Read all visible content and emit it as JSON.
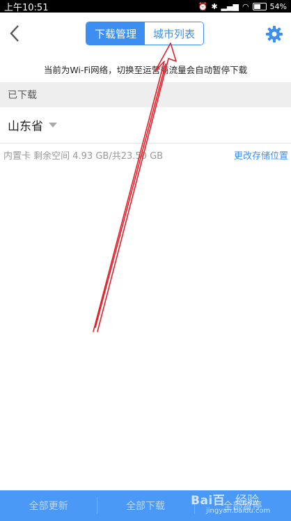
{
  "status_bar": {
    "time": "上午10:51",
    "battery": "54%",
    "battery_fraction": 0.54
  },
  "header": {
    "tabs": [
      {
        "label": "下载管理",
        "active": true
      },
      {
        "label": "城市列表",
        "active": false
      }
    ]
  },
  "notice": "当前为Wi-Fi网络，切换至运营商流量会自动暂停下载",
  "downloaded_section": {
    "title": "已下载",
    "province": "山东省"
  },
  "storage": {
    "info": "内置卡 剩余空间 4.93 GB/共23.50 GB",
    "change_link": "更改存储位置"
  },
  "bottom_bar": {
    "update_all": "全部更新",
    "download_all": "全部下载",
    "third": "全部暂停"
  },
  "watermark": {
    "logo": "Bai百",
    "text": "经验",
    "url": "jingyan.baidu.com"
  },
  "colors": {
    "accent": "#3c8ff0",
    "bottom_bar": "#4a99f6",
    "annotation_arrow": "#e0212b"
  }
}
